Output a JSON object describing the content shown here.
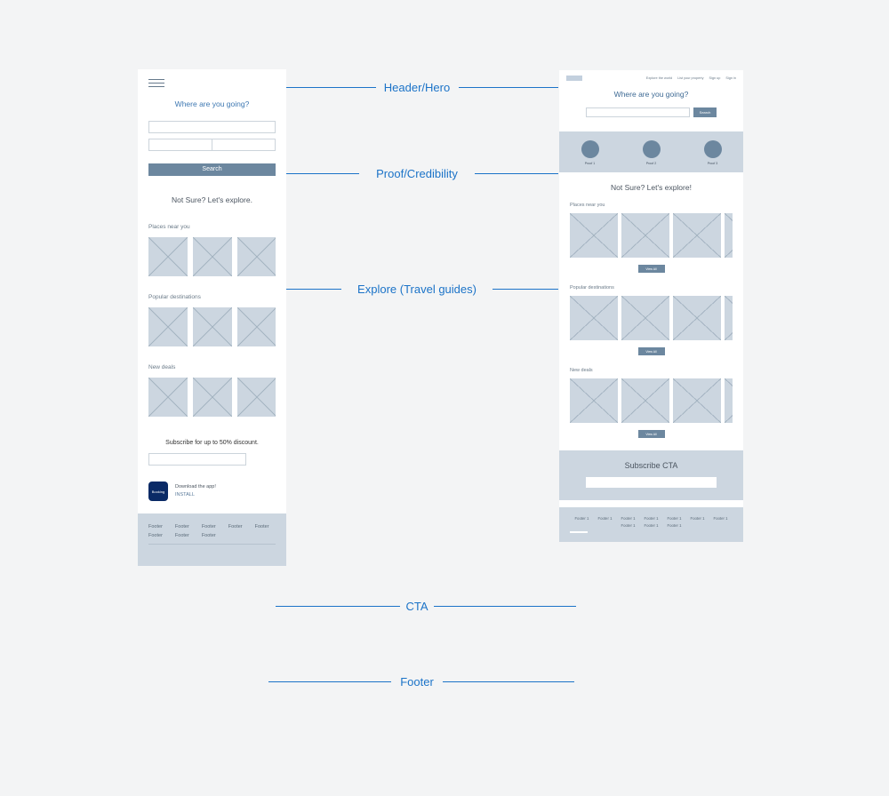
{
  "annotations": {
    "header": "Header/Hero",
    "proof": "Proof/Credibility",
    "explore": "Explore (Travel guides)",
    "cta": "CTA",
    "footer": "Footer"
  },
  "mobile": {
    "hero_question": "Where are you going?",
    "search_button": "Search",
    "explore_title": "Not Sure? Let's explore.",
    "section_places": "Places near you",
    "section_popular": "Popular destinations",
    "section_deals": "New deals",
    "subscribe_title": "Subscribe for up to 50% discount.",
    "app_icon_label": "Booking",
    "app_download": "Download the app!",
    "app_install": "INSTALL",
    "footer_link": "Footer"
  },
  "desktop": {
    "nav": {
      "explore": "Explore the world",
      "list": "List your property",
      "signup": "Sign up",
      "signin": "Sign in"
    },
    "hero_question": "Where are you going?",
    "search_button": "Search",
    "proof1": "Proof 1",
    "proof2": "Proof 2",
    "proof3": "Proof 3",
    "explore_title": "Not Sure? Let's explore!",
    "section_places": "Places near you",
    "section_popular": "Popular destinations",
    "section_deals": "New deals",
    "view_all": "View All",
    "subscribe_title": "Subscribe CTA",
    "footer_link": "Footer 1"
  }
}
